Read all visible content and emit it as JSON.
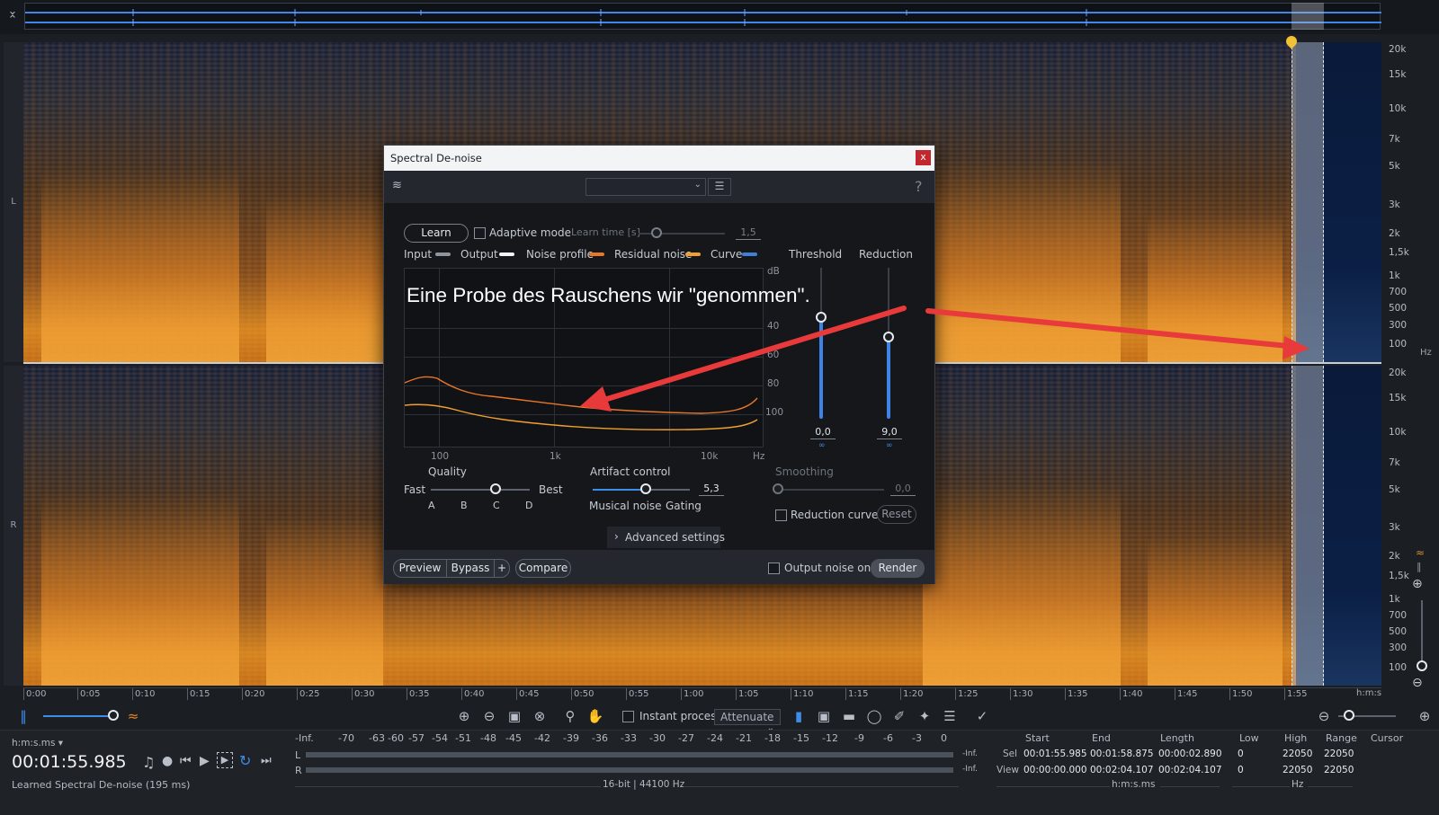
{
  "ruler": {
    "freq_labels_top": [
      "20k",
      "15k",
      "10k",
      "7k",
      "5k",
      "3k",
      "2k",
      "1,5k",
      "1k",
      "700",
      "500",
      "300",
      "100",
      "Hz"
    ],
    "freq_labels_bottom": [
      "20k",
      "15k",
      "10k",
      "7k",
      "5k",
      "3k",
      "2k",
      "1,5k",
      "1k",
      "700",
      "500",
      "300",
      "100"
    ],
    "channels": [
      "L",
      "R"
    ],
    "time_ticks": [
      "0:00",
      "0:05",
      "0:10",
      "0:15",
      "0:20",
      "0:25",
      "0:30",
      "0:35",
      "0:40",
      "0:45",
      "0:50",
      "0:55",
      "1:00",
      "1:05",
      "1:10",
      "1:15",
      "1:20",
      "1:25",
      "1:30",
      "1:35",
      "1:40",
      "1:45",
      "1:50",
      "1:55"
    ],
    "time_unit": "h:m:s"
  },
  "toolbar": {
    "instant_process_label": "Instant process",
    "instant_process_checked": false,
    "mode_value": "Attenuate",
    "zoom_level": 0.82
  },
  "dialog": {
    "title": "Spectral De-noise",
    "close_label": "x",
    "preset_value": "",
    "help_label": "?",
    "learn_label": "Learn",
    "adaptive_mode_label": "Adaptive mode",
    "adaptive_mode_checked": false,
    "learn_time_label": "Learn time [s]",
    "learn_time_value": "1,5",
    "legend": [
      {
        "label": "Input",
        "color": "#8e959f"
      },
      {
        "label": "Output",
        "color": "#f2f3f5"
      },
      {
        "label": "Noise profile",
        "color": "#e8772a"
      },
      {
        "label": "Residual noise",
        "color": "#f0a030"
      },
      {
        "label": "Curve",
        "color": "#3f7fd6"
      }
    ],
    "graph": {
      "db_unit": "dB",
      "db_labels": [
        "40",
        "60",
        "80",
        "100"
      ],
      "freq_labels": [
        "100",
        "1k",
        "10k",
        "Hz"
      ]
    },
    "threshold_label": "Threshold",
    "threshold_value": "0,0",
    "threshold_level": 0.33,
    "reduction_label": "Reduction",
    "reduction_value": "9,0",
    "reduction_level": 0.22,
    "quality": {
      "label": "Quality",
      "fast": "Fast",
      "best": "Best",
      "options": [
        "A",
        "B",
        "C",
        "D"
      ],
      "selected": "C"
    },
    "artifact": {
      "label": "Artifact control",
      "value": "5,3",
      "left": "Musical noise",
      "right": "Gating"
    },
    "smoothing": {
      "label": "Smoothing",
      "value": "0,0"
    },
    "reduction_curve_label": "Reduction curve",
    "reduction_curve_checked": false,
    "reset_label": "Reset",
    "advanced_label": "Advanced settings",
    "preview_label": "Preview",
    "bypass_label": "Bypass",
    "plus_label": "+",
    "compare_label": "Compare",
    "output_noise_label": "Output noise only",
    "output_noise_checked": false,
    "render_label": "Render"
  },
  "annotation": {
    "text": "Eine Probe des Rauschens wir \"genommen\".",
    "color": "#e83a3a"
  },
  "transport": {
    "time_format": "h:m:s.ms",
    "time": "00:01:55.985",
    "status": "Learned Spectral De-noise (195 ms)"
  },
  "meter": {
    "scale": [
      "-Inf.",
      "-70",
      "-63",
      "-60",
      "-57",
      "-54",
      "-51",
      "-48",
      "-45",
      "-42",
      "-39",
      "-36",
      "-33",
      "-30",
      "-27",
      "-24",
      "-21",
      "-18",
      "-15",
      "-12",
      "-9",
      "-6",
      "-3",
      "0"
    ],
    "l_label": "L",
    "r_label": "R",
    "l_peak": "-Inf.",
    "r_peak": "-Inf.",
    "format": "16-bit | 44100 Hz"
  },
  "selection": {
    "headers": [
      "Start",
      "End",
      "Length",
      "Low",
      "High",
      "Range",
      "Cursor"
    ],
    "sel_label": "Sel",
    "view_label": "View",
    "sel": [
      "00:01:55.985",
      "00:01:58.875",
      "00:00:02.890",
      "0",
      "22050",
      "22050"
    ],
    "view": [
      "00:00:00.000",
      "00:02:04.107",
      "00:02:04.107",
      "0",
      "22050",
      "22050"
    ],
    "time_unit": "h:m:s.ms",
    "freq_unit": "Hz"
  },
  "colors": {
    "accent": "#3d8de8",
    "spectrogram": "#e8872a",
    "close": "#c2272d"
  }
}
